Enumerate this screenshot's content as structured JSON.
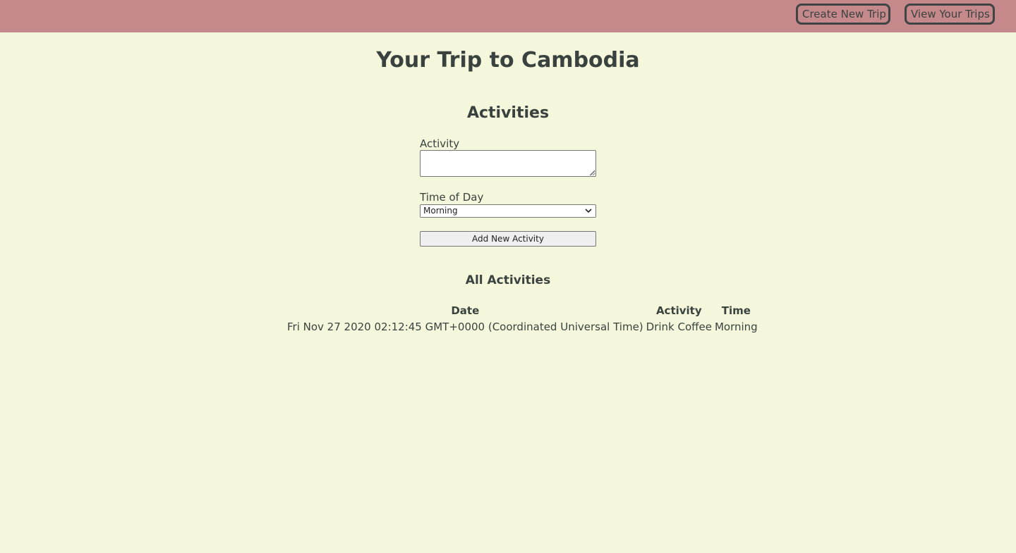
{
  "nav": {
    "create_trip": "Create New Trip",
    "view_trips": "View Your Trips"
  },
  "page": {
    "title": "Your Trip to Cambodia"
  },
  "form": {
    "section_title": "Activities",
    "activity_label": "Activity",
    "activity_value": "",
    "time_label": "Time of Day",
    "time_selected": "Morning",
    "add_button": "Add New Activity"
  },
  "list": {
    "title": "All Activities",
    "columns": [
      "Date",
      "Activity",
      "Time"
    ],
    "rows": [
      {
        "date": "Fri Nov 27 2020 02:12:45 GMT+0000 (Coordinated Universal Time)",
        "activity": "Drink Coffee",
        "time": "Morning"
      }
    ]
  },
  "colors": {
    "header_bg": "#c5898c",
    "page_bg": "#f4f7dc",
    "text": "#3a423f"
  }
}
